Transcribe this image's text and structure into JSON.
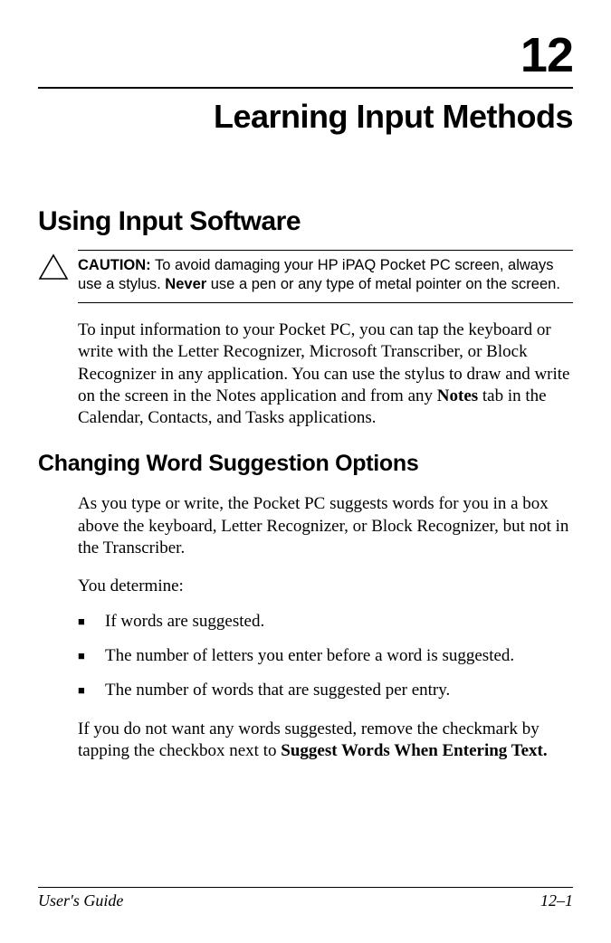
{
  "chapter": {
    "number": "12",
    "title": "Learning Input Methods"
  },
  "section1": {
    "heading": "Using Input Software",
    "caution_label": "CAUTION:",
    "caution_before": " To avoid damaging your HP iPAQ Pocket PC screen, always use a stylus. ",
    "caution_bold": "Never",
    "caution_after": " use a pen or any type of metal pointer on the screen.",
    "para_before": "To input information to your Pocket PC, you can tap the keyboard or write with the Letter Recognizer, Microsoft Transcriber, or Block Recognizer in any application. You can use the stylus to draw and write on the screen in the Notes application and from any ",
    "para_bold": "Notes",
    "para_after": " tab in the Calendar, Contacts, and Tasks applications."
  },
  "section2": {
    "heading": "Changing Word Suggestion Options",
    "para1": "As you type or write, the Pocket PC suggests words for you in a box above the keyboard, Letter Recognizer, or Block Recognizer, but not in the Transcriber.",
    "para2": "You determine:",
    "bullets": [
      "If words are suggested.",
      "The number of letters you enter before a word is suggested.",
      "The number of words that are suggested per entry."
    ],
    "para3_before": "If you do not want any words suggested, remove the checkmark by tapping the checkbox next to ",
    "para3_bold": "Suggest Words When Entering Text."
  },
  "footer": {
    "left": "User's Guide",
    "right": "12–1"
  }
}
